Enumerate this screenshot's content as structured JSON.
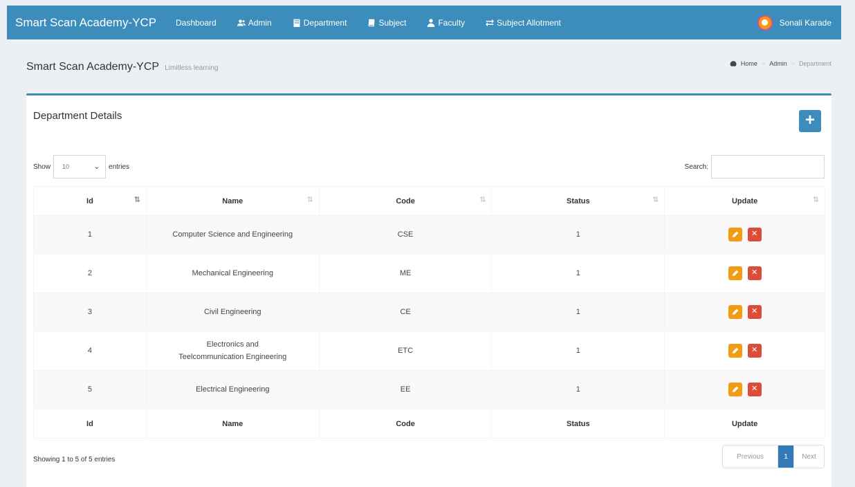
{
  "brand": "Smart Scan Academy-YCP",
  "nav": {
    "items": [
      {
        "label": "Dashboard",
        "icon": ""
      },
      {
        "label": "Admin",
        "icon": "users-icon"
      },
      {
        "label": "Department",
        "icon": "building-icon"
      },
      {
        "label": "Subject",
        "icon": "book-icon"
      },
      {
        "label": "Faculty",
        "icon": "user-tie-icon"
      },
      {
        "label": "Subject Allotment",
        "icon": "exchange-icon"
      }
    ],
    "user_name": "Sonali Karade"
  },
  "header": {
    "title": "Smart Scan Academy-YCP",
    "subtitle": "Limitless learning",
    "breadcrumb": [
      "Home",
      "Admin",
      "Department"
    ]
  },
  "box": {
    "title": "Department Details",
    "add_label": "+"
  },
  "controls": {
    "show_label": "Show",
    "entries_label": "entries",
    "page_length": "10",
    "search_label": "Search:"
  },
  "table": {
    "columns": [
      "Id",
      "Name",
      "Code",
      "Status",
      "Update"
    ],
    "rows": [
      {
        "id": "1",
        "name": "Computer Science and Engineering",
        "code": "CSE",
        "status": "1"
      },
      {
        "id": "2",
        "name": "Mechanical Engineering",
        "code": "ME",
        "status": "1"
      },
      {
        "id": "3",
        "name": "Civil Engineering",
        "code": "CE",
        "status": "1"
      },
      {
        "id": "4",
        "name": "Electronics and Teelcommunication Engineering",
        "code": "ETC",
        "status": "1"
      },
      {
        "id": "5",
        "name": "Electrical Engineering",
        "code": "EE",
        "status": "1"
      }
    ]
  },
  "footer": {
    "info": "Showing 1 to 5 of 5 entries",
    "prev": "Previous",
    "current_page": "1",
    "next": "Next"
  },
  "colors": {
    "primary": "#3c8dbc",
    "edit": "#f39c12",
    "delete": "#dd4b39",
    "page_active": "#337ab7"
  }
}
